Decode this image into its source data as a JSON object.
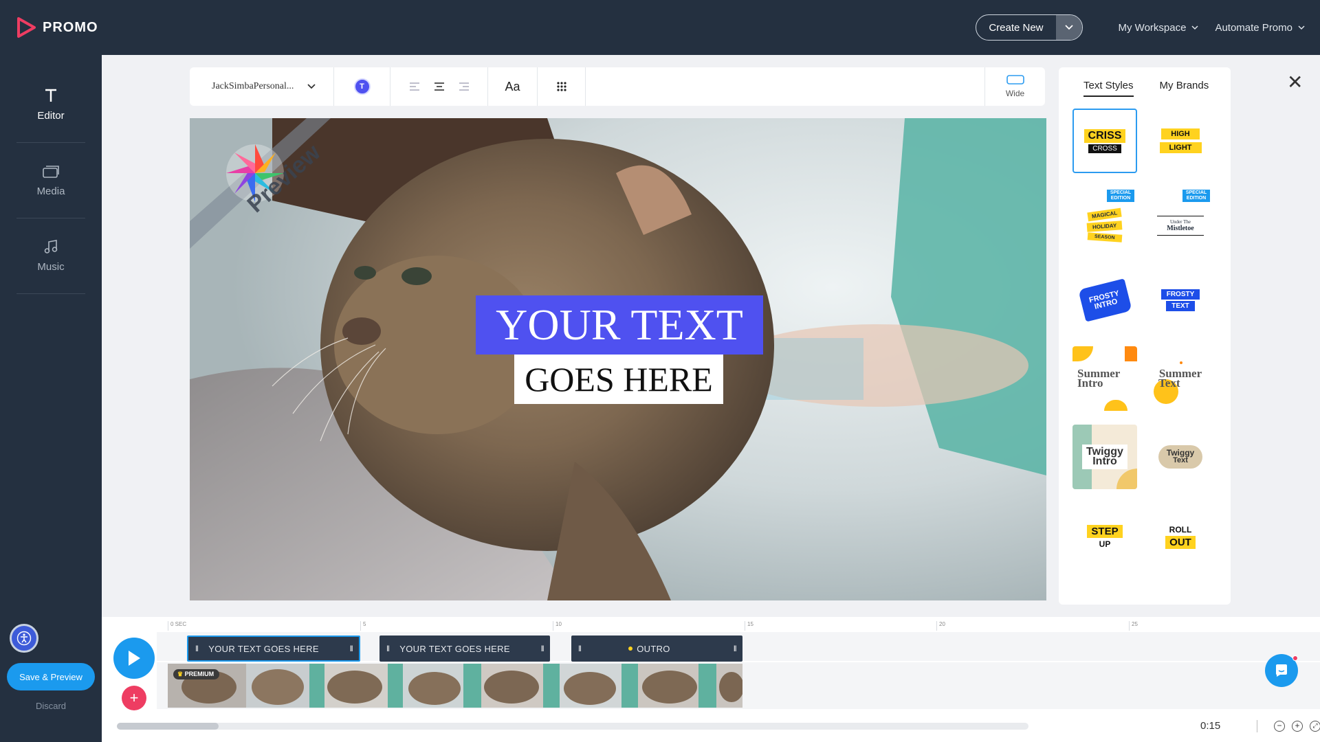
{
  "brand": {
    "name": "PROMO",
    "accent": "#ee3d62"
  },
  "topbar": {
    "create_new": "Create New",
    "workspace": "My Workspace",
    "automate": "Automate Promo"
  },
  "sidebar": {
    "items": [
      {
        "label": "Editor",
        "icon": "text-t-icon",
        "active": true
      },
      {
        "label": "Media",
        "icon": "media-icon",
        "active": false
      },
      {
        "label": "Music",
        "icon": "music-note-icon",
        "active": false
      }
    ],
    "save_preview": "Save & Preview",
    "discard": "Discard"
  },
  "toolbar": {
    "font": "JackSimbaPersonal...",
    "color_letter": "T",
    "text_color": "#4f51f0",
    "font_size_label": "Aa",
    "wide_label": "Wide"
  },
  "canvas": {
    "line1": "YOUR TEXT",
    "line2": "GOES HERE",
    "watermark": "Preview"
  },
  "styles_panel": {
    "tabs": [
      "Text Styles",
      "My Brands"
    ],
    "active_tab": "Text Styles",
    "tiles": [
      {
        "top": "CRISS",
        "bottom": "CROSS"
      },
      {
        "top": "HIGH",
        "bottom": "LIGHT"
      },
      {
        "badge": "SPECIAL EDITION",
        "lines": [
          "MAGICAL",
          "HOLIDAY",
          "SEASON"
        ]
      },
      {
        "badge": "SPECIAL EDITION",
        "lines": [
          "Under The",
          "Mistletoe"
        ]
      },
      {
        "lines": [
          "FROSTY",
          "INTRO"
        ]
      },
      {
        "lines": [
          "FROSTY",
          "TEXT"
        ]
      },
      {
        "lines": [
          "Summer",
          "Intro"
        ]
      },
      {
        "lines": [
          "Summer",
          "Text"
        ]
      },
      {
        "lines": [
          "Twiggy",
          "Intro"
        ]
      },
      {
        "lines": [
          "Twiggy",
          "Text"
        ]
      },
      {
        "top": "STEP",
        "bottom": "UP"
      },
      {
        "top": "ROLL",
        "bottom": "OUT"
      }
    ]
  },
  "timeline": {
    "ruler": [
      "0 SEC",
      "5",
      "10",
      "15",
      "20",
      "25"
    ],
    "clips": [
      "YOUR TEXT GOES HERE",
      "YOUR TEXT GOES HERE",
      "OUTRO"
    ],
    "premium": "PREMIUM",
    "time": "0:15"
  }
}
